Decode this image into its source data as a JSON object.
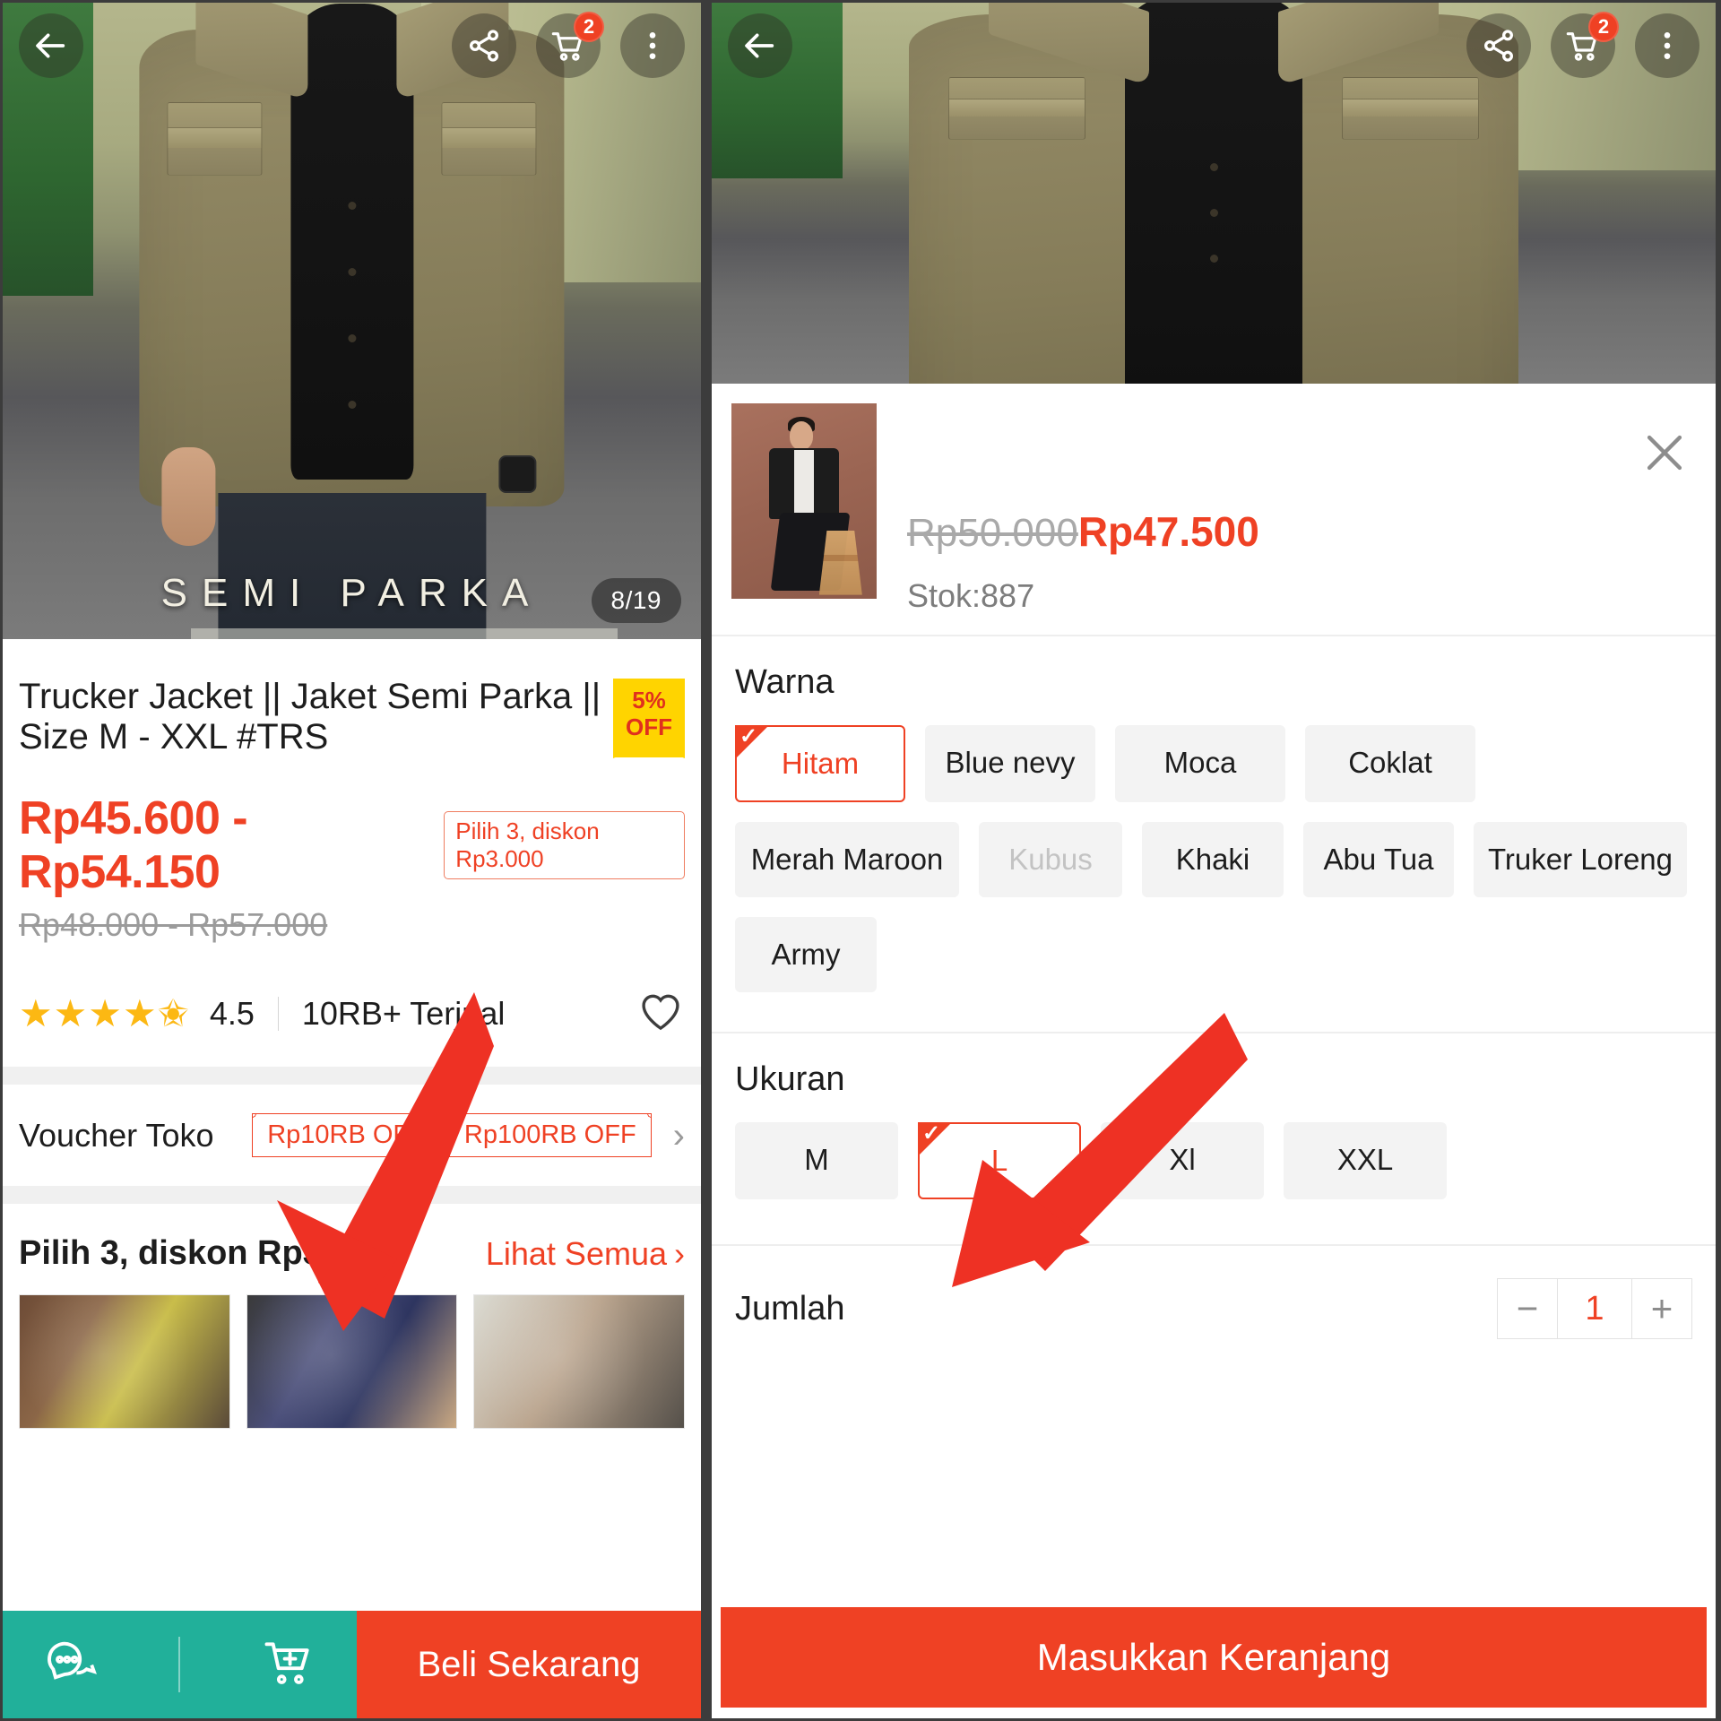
{
  "left": {
    "header": {
      "back_icon": "arrow-left-icon",
      "share_icon": "share-icon",
      "cart_icon": "cart-icon",
      "cart_badge": "2",
      "more_icon": "more-vertical-icon"
    },
    "gallery": {
      "counter": "8/19",
      "watermark": "SEMI PARKA"
    },
    "product": {
      "title": "Trucker Jacket || Jaket Semi Parka || Size M - XXL #TRS",
      "discount_badge_percent": "5%",
      "discount_badge_label": "OFF",
      "price_range": "Rp45.600 - Rp54.150",
      "promo_pill": "Pilih 3, diskon Rp3.000",
      "price_old": "Rp48.000 - Rp57.000",
      "rating_value": "4.5",
      "sold": "10RB+ Terjual",
      "favorite_icon": "heart-icon"
    },
    "voucher": {
      "label": "Voucher Toko",
      "items": [
        "Rp10RB OFF",
        "Rp100RB OFF"
      ],
      "chevron": "chevron-right-icon"
    },
    "bundle": {
      "title": "Pilih 3, diskon Rp3.000",
      "see_all": "Lihat Semua",
      "see_all_chevron": "chevron-right-icon"
    },
    "bottom_bar": {
      "chat_icon": "chat-bubble-icon",
      "add_cart_icon": "cart-plus-icon",
      "buy_label": "Beli Sekarang"
    }
  },
  "right": {
    "header": {
      "back_icon": "arrow-left-icon",
      "share_icon": "share-icon",
      "cart_icon": "cart-icon",
      "cart_badge": "2",
      "more_icon": "more-vertical-icon"
    },
    "sheet": {
      "close_icon": "close-icon",
      "price_old": "Rp50.000",
      "price_new": "Rp47.500",
      "stock": "Stok:887",
      "color": {
        "title": "Warna",
        "options": [
          {
            "label": "Hitam",
            "state": "selected"
          },
          {
            "label": "Blue nevy",
            "state": "normal"
          },
          {
            "label": "Moca",
            "state": "normal"
          },
          {
            "label": "Coklat",
            "state": "normal"
          },
          {
            "label": "Merah Maroon",
            "state": "normal"
          },
          {
            "label": "Kubus",
            "state": "disabled"
          },
          {
            "label": "Khaki",
            "state": "normal"
          },
          {
            "label": "Abu Tua",
            "state": "normal"
          },
          {
            "label": "Truker Loreng",
            "state": "normal"
          },
          {
            "label": "Army",
            "state": "normal"
          }
        ]
      },
      "size": {
        "title": "Ukuran",
        "options": [
          {
            "label": "M",
            "state": "normal"
          },
          {
            "label": "L",
            "state": "selected"
          },
          {
            "label": "Xl",
            "state": "normal"
          },
          {
            "label": "XXL",
            "state": "normal"
          }
        ]
      },
      "quantity": {
        "label": "Jumlah",
        "minus_icon": "minus-icon",
        "value": "1",
        "plus_icon": "plus-icon"
      },
      "cta_label": "Masukkan Keranjang"
    }
  },
  "annotations": {
    "arrow_color": "#ee3124",
    "arrows": [
      "pointer-to-bundle-thumbnail",
      "pointer-to-add-to-cart-button"
    ]
  },
  "colors": {
    "accent_orange": "#ef4124",
    "chat_teal": "#21b09a",
    "badge_yellow": "#ffd400",
    "star_yellow": "#fcb813"
  }
}
